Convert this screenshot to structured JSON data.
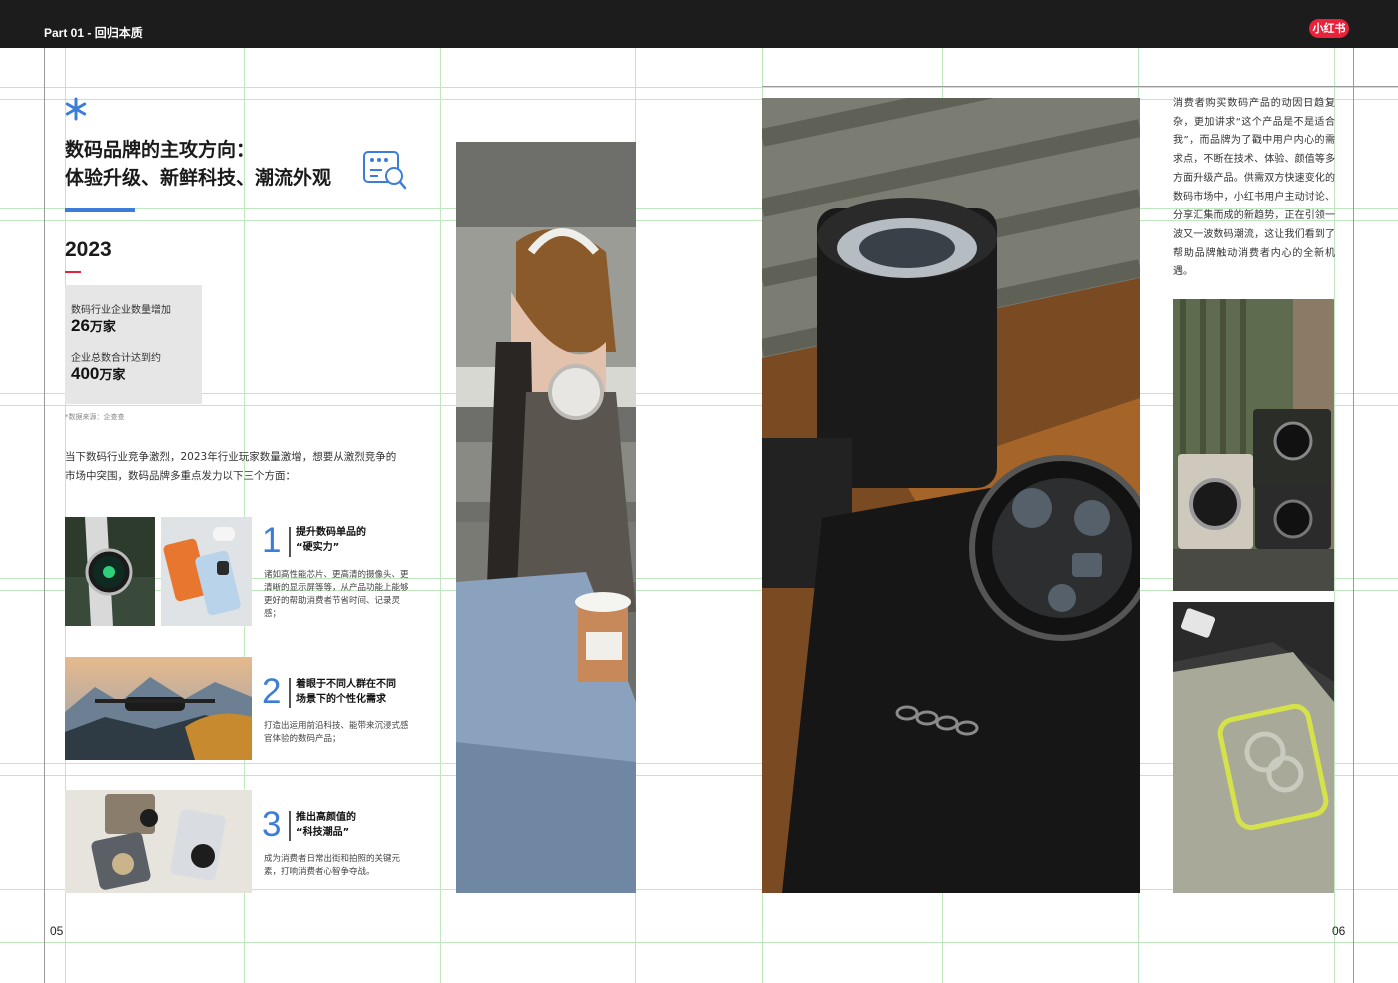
{
  "header": {
    "part_label": "Part 01 - 回归本质",
    "brand_badge": "小红书"
  },
  "left_page": {
    "title_line1": "数码品牌的主攻方向：",
    "title_line2": "体验升级、新鲜科技、潮流外观",
    "year": "2023",
    "stats": [
      {
        "label": "数码行业企业数量增加",
        "value": "26",
        "unit": "万家"
      },
      {
        "label": "企业总数合计达到约",
        "value": "400",
        "unit": "万家"
      }
    ],
    "source": "*数据来源：企查查",
    "intro_line1": "当下数码行业竞争激烈，2023年行业玩家数量激增，想要从激烈竞争的",
    "intro_line2": "市场中突围，数码品牌多重点发力以下三个方面：",
    "items": [
      {
        "number": "1",
        "head_line1": "提升数码单品的",
        "head_line2": "“硬实力”",
        "desc": "诸如高性能芯片、更高清的摄像头、更清晰的显示屏等等，从产品功能上能够更好的帮助消费者节省时间、记录灵感；"
      },
      {
        "number": "2",
        "head_line1": "着眼于不同人群在不同",
        "head_line2": "场景下的个性化需求",
        "desc": "打造出运用前沿科技、能带来沉浸式感官体验的数码产品；"
      },
      {
        "number": "3",
        "head_line1": "推出高颜值的",
        "head_line2": "“科技潮品”",
        "desc": "成为消费者日常出街和拍照的关键元素，打响消费者心智争夺战。"
      }
    ],
    "page_number": "05"
  },
  "right_page": {
    "paragraph": "消费者购买数码产品的动因日趋复杂，更加讲求“这个产品是不是适合我”，而品牌为了戳中用户内心的需求点，不断在技术、体验、颜值等多方面升级产品。供需双方快速变化的数码市场中，小红书用户主动讨论、分享汇集而成的新趋势，正在引领一波又一波数码潮流，这让我们看到了帮助品牌触动消费者内心的全新机遇。",
    "page_number": "06"
  },
  "colors": {
    "accent_blue": "#3b7dd8",
    "accent_red": "#e8223a",
    "header_bg": "#1c1c1c"
  },
  "icons": [
    "asterisk-icon",
    "search-document-icon"
  ]
}
